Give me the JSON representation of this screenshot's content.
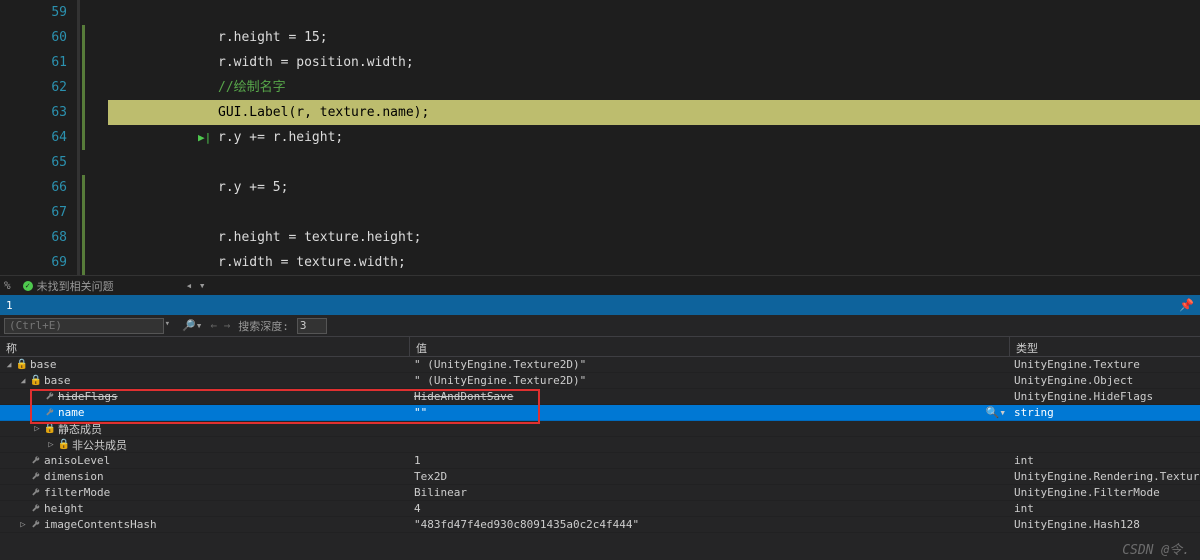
{
  "code": {
    "lines": [
      {
        "n": 59,
        "text": ""
      },
      {
        "n": 60,
        "text": "r.height = 15;"
      },
      {
        "n": 61,
        "text": "r.width = position.width;"
      },
      {
        "n": 62,
        "text": "//绘制名字",
        "comment": true
      },
      {
        "n": 63,
        "text": "GUI.Label(r, texture.name);",
        "highlight": true
      },
      {
        "n": 64,
        "text": "r.y += r.height;",
        "run_indicator": true
      },
      {
        "n": 65,
        "text": ""
      },
      {
        "n": 66,
        "text": "r.y += 5;"
      },
      {
        "n": 67,
        "text": ""
      },
      {
        "n": 68,
        "text": "r.height = texture.height;"
      },
      {
        "n": 69,
        "text": "r.width = texture.width;"
      }
    ]
  },
  "status": {
    "percent": "%",
    "issues": "未找到相关问题"
  },
  "panel": {
    "title": "1"
  },
  "search": {
    "placeholder": "(Ctrl+E)",
    "depth_label": "搜索深度:",
    "depth_value": "3"
  },
  "table": {
    "headers": {
      "name": "称",
      "value": "值",
      "type": "类型"
    },
    "rows": [
      {
        "indent": 0,
        "exp": "▢",
        "icon": "lock",
        "name": "base",
        "value": "\" (UnityEngine.Texture2D)\"",
        "type": "UnityEngine.Texture"
      },
      {
        "indent": 1,
        "exp": "▢",
        "icon": "lock",
        "name": "base",
        "value": "\" (UnityEngine.Texture2D)\"",
        "type": "UnityEngine.Object"
      },
      {
        "indent": 2,
        "exp": "",
        "icon": "wrench",
        "name": "hideFlags",
        "value": "HideAndDontSave",
        "type": "UnityEngine.HideFlags",
        "strike": true
      },
      {
        "indent": 2,
        "exp": "",
        "icon": "wrench",
        "name": "name",
        "value": "\"\"",
        "type": "string",
        "selected": true,
        "magnify": true
      },
      {
        "indent": 2,
        "exp": "▷",
        "icon": "lock",
        "name": "静态成员",
        "value": "",
        "type": ""
      },
      {
        "indent": 3,
        "exp": "▷",
        "icon": "lock",
        "name": "非公共成员",
        "value": "",
        "type": ""
      },
      {
        "indent": 1,
        "exp": "",
        "icon": "wrench",
        "name": "anisoLevel",
        "value": "1",
        "type": "int"
      },
      {
        "indent": 1,
        "exp": "",
        "icon": "wrench",
        "name": "dimension",
        "value": "Tex2D",
        "type": "UnityEngine.Rendering.TextureDime"
      },
      {
        "indent": 1,
        "exp": "",
        "icon": "wrench",
        "name": "filterMode",
        "value": "Bilinear",
        "type": "UnityEngine.FilterMode"
      },
      {
        "indent": 1,
        "exp": "",
        "icon": "wrench",
        "name": "height",
        "value": "4",
        "type": "int"
      },
      {
        "indent": 1,
        "exp": "▷",
        "icon": "wrench",
        "name": "imageContentsHash",
        "value": "\"483fd47f4ed930c8091435a0c2c4f444\"",
        "type": "UnityEngine.Hash128"
      }
    ]
  },
  "watermark": "CSDN @令."
}
